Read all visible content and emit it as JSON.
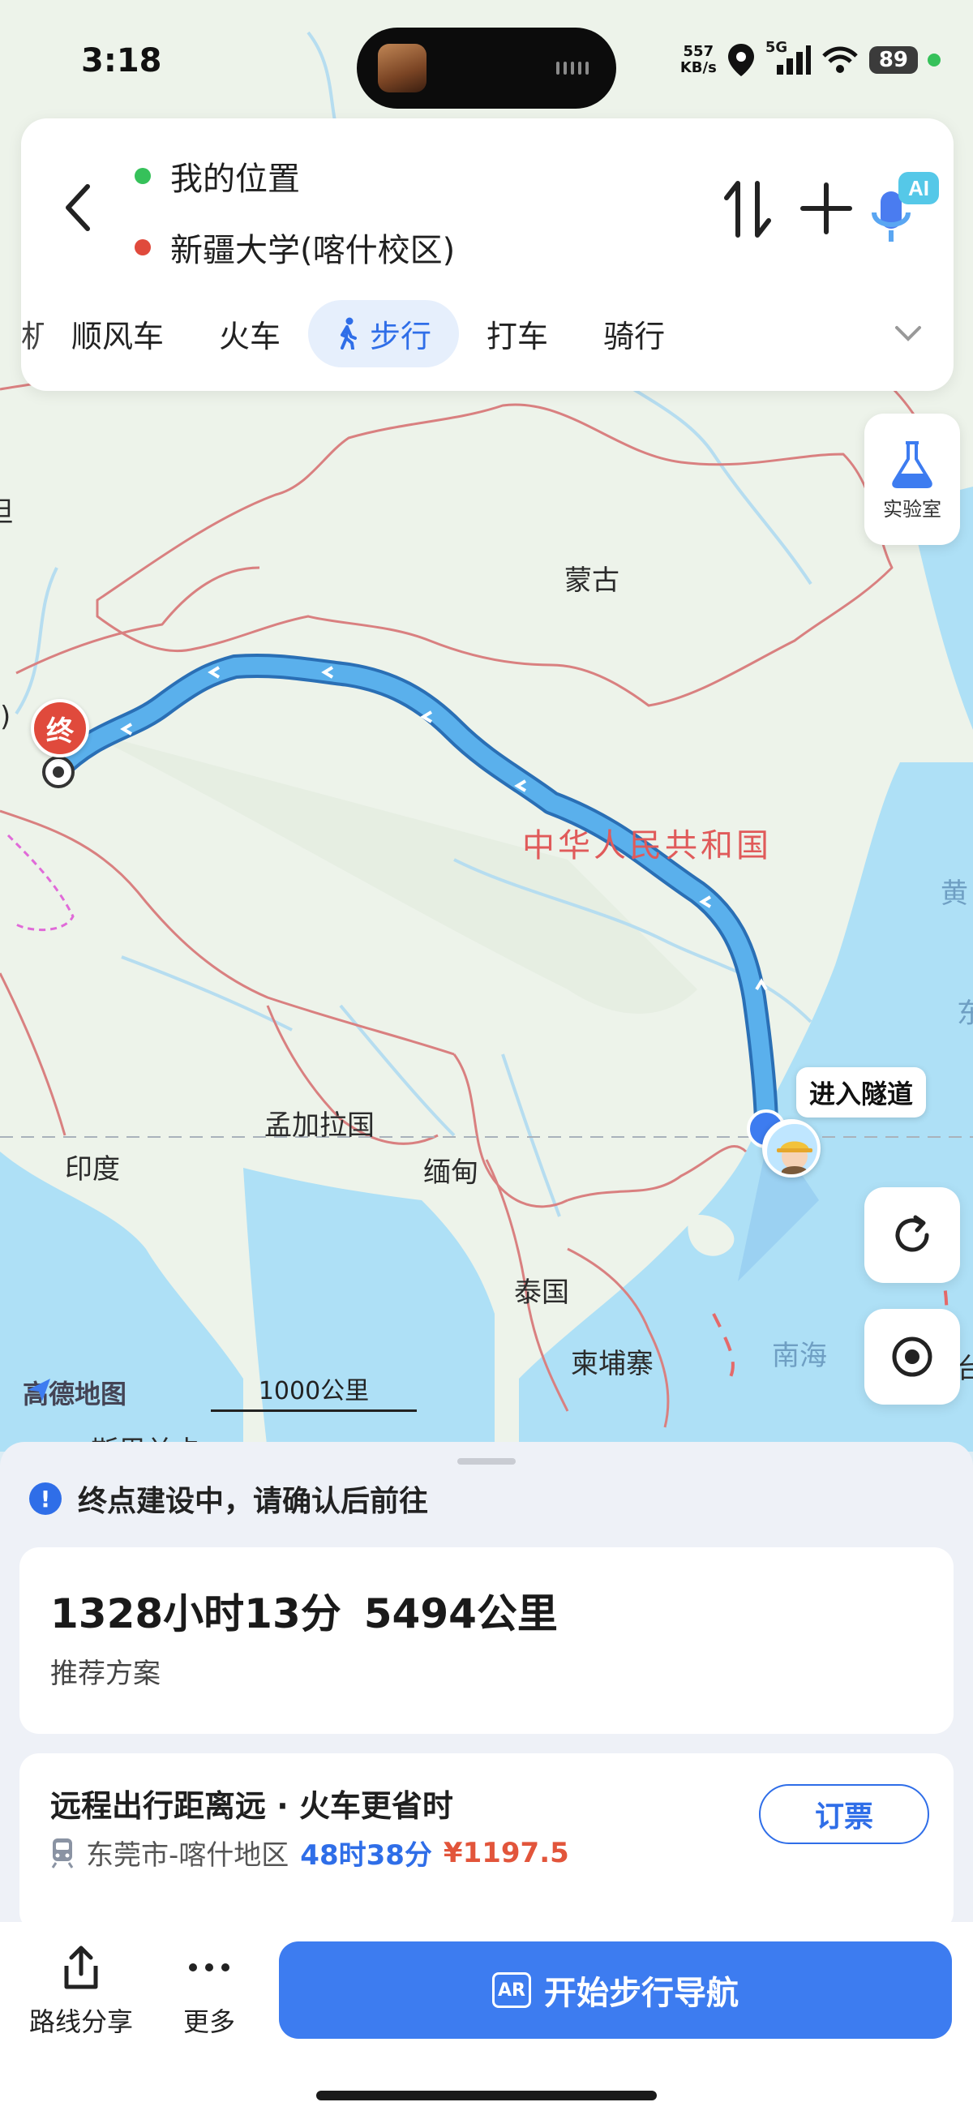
{
  "status_bar": {
    "time": "3:18",
    "net_speed_value": "557",
    "net_speed_unit": "KB/s",
    "network": "5G",
    "battery": "89"
  },
  "search": {
    "origin": "我的位置",
    "destination": "新疆大学(喀什校区)",
    "origin_color": "#36c15a",
    "destination_color": "#e04a3c",
    "voice_badge": "AI"
  },
  "modes": {
    "partial_left": "机",
    "items": [
      "顺风车",
      "火车",
      "步行",
      "打车",
      "骑行"
    ],
    "active": "步行"
  },
  "map": {
    "labels": {
      "mongolia": "蒙古",
      "china": "中华人民共和国",
      "bangladesh": "孟加拉国",
      "india": "印度",
      "myanmar": "缅甸",
      "thailand": "泰国",
      "cambodia": "柬埔寨",
      "south_sea": "南海",
      "sri_lanka_partial": "斯里兰卡",
      "yellow_partial": "黄",
      "east_partial": "东",
      "tai_partial": "台",
      "left_partial_a": "坦",
      "left_partial_b": ")"
    },
    "end_marker": "终",
    "tunnel_tag": "进入隧道",
    "lab_label": "实验室",
    "brand": "高德地图",
    "scale": "1000公里",
    "route_color": "#4aa8e8"
  },
  "sheet": {
    "notice": "终点建设中，请确认后前往",
    "route_time": "1328小时13分",
    "route_distance": "5494公里",
    "route_tag": "推荐方案",
    "rec_title": "远程出行距离远 · 火车更省时",
    "rec_route": "东莞市-喀什地区",
    "rec_duration": "48时38分",
    "rec_price": "¥1197.5",
    "book_label": "订票"
  },
  "bottom": {
    "share_label": "路线分享",
    "more_label": "更多",
    "start_label": "开始步行导航",
    "ar_badge": "AR"
  }
}
